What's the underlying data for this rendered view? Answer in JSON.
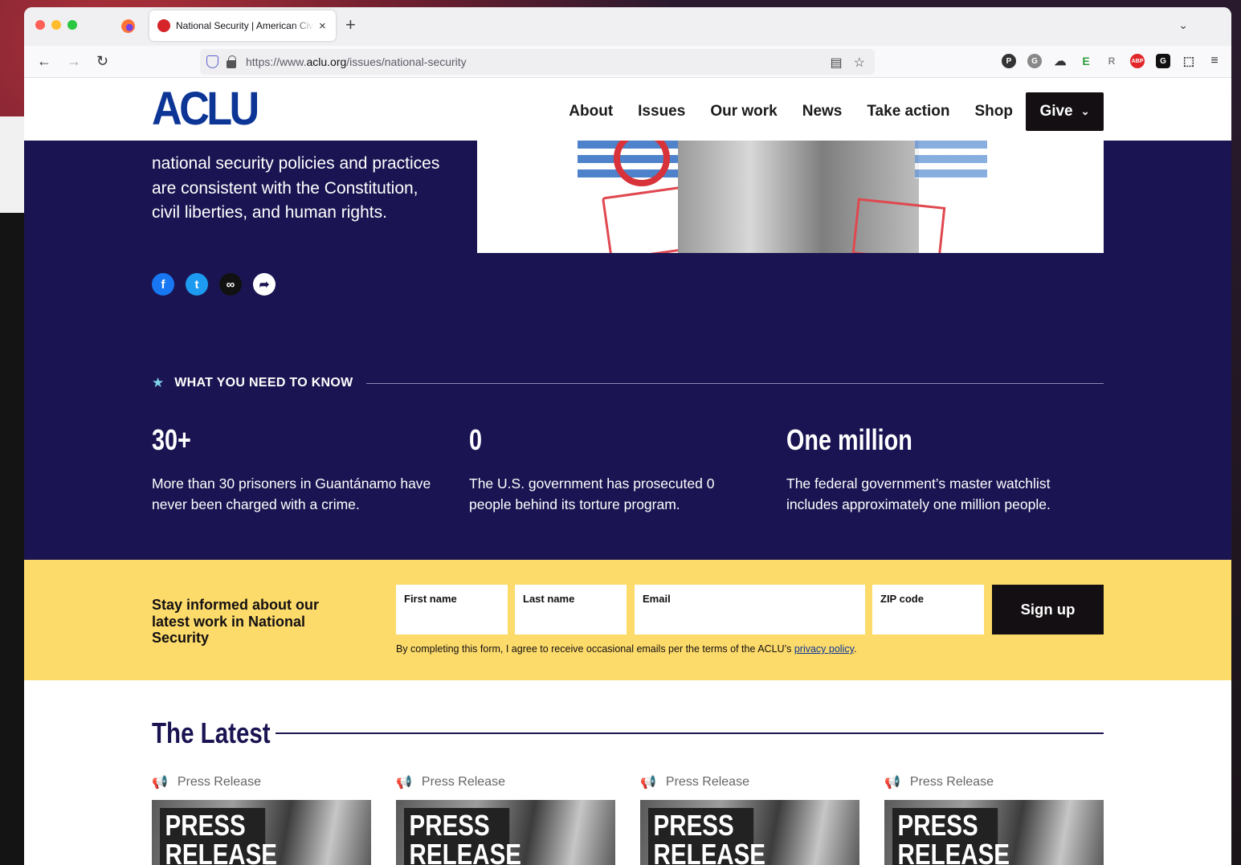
{
  "browser": {
    "tab_title": "National Security | American Civil Liberties Union",
    "tab_close": "×",
    "new_tab": "+",
    "tab_list": "⌄",
    "url_prefix": "https://www.",
    "url_domain": "aclu.org",
    "url_path": "/issues/national-security",
    "back": "←",
    "forward": "→",
    "reload": "↻"
  },
  "site": {
    "logo": "ACLU",
    "nav": [
      "About",
      "Issues",
      "Our work",
      "News",
      "Take action",
      "Shop"
    ],
    "give_label": "Give",
    "give_chevron": "⌄",
    "intro_clipped": "",
    "intro_text": "national security policies and practices are consistent with the Constitution, civil liberties, and human rights.",
    "know_label": "WHAT YOU NEED TO KNOW",
    "stats": [
      {
        "num": "30+",
        "desc": "More than 30 prisoners in Guantánamo have never been charged with a crime."
      },
      {
        "num": "0",
        "desc": "The U.S. government has prosecuted 0 people behind its torture program."
      },
      {
        "num": "One million",
        "desc": "The federal government’s master watchlist includes approximately one million people."
      }
    ],
    "signup": {
      "title": "Stay informed about our latest work in National Security",
      "first_name": "First name",
      "last_name": "Last name",
      "email": "Email",
      "zip": "ZIP code",
      "button": "Sign up",
      "disclaimer": "By completing this form, I agree to receive occasional emails per the terms of the ACLU’s ",
      "privacy": "privacy policy",
      "period": "."
    },
    "latest_title": "The Latest",
    "cards": [
      {
        "type": "Press Release",
        "label": "PRESS RELEASE"
      },
      {
        "type": "Press Release",
        "label": "PRESS RELEASE"
      },
      {
        "type": "Press Release",
        "label": "PRESS RELEASE"
      },
      {
        "type": "Press Release",
        "label": "PRESS RELEASE"
      }
    ]
  },
  "colors": {
    "navy": "#1a1552",
    "aclu_blue": "#0d3596",
    "yellow": "#fcdb6a",
    "black": "#130f12"
  }
}
